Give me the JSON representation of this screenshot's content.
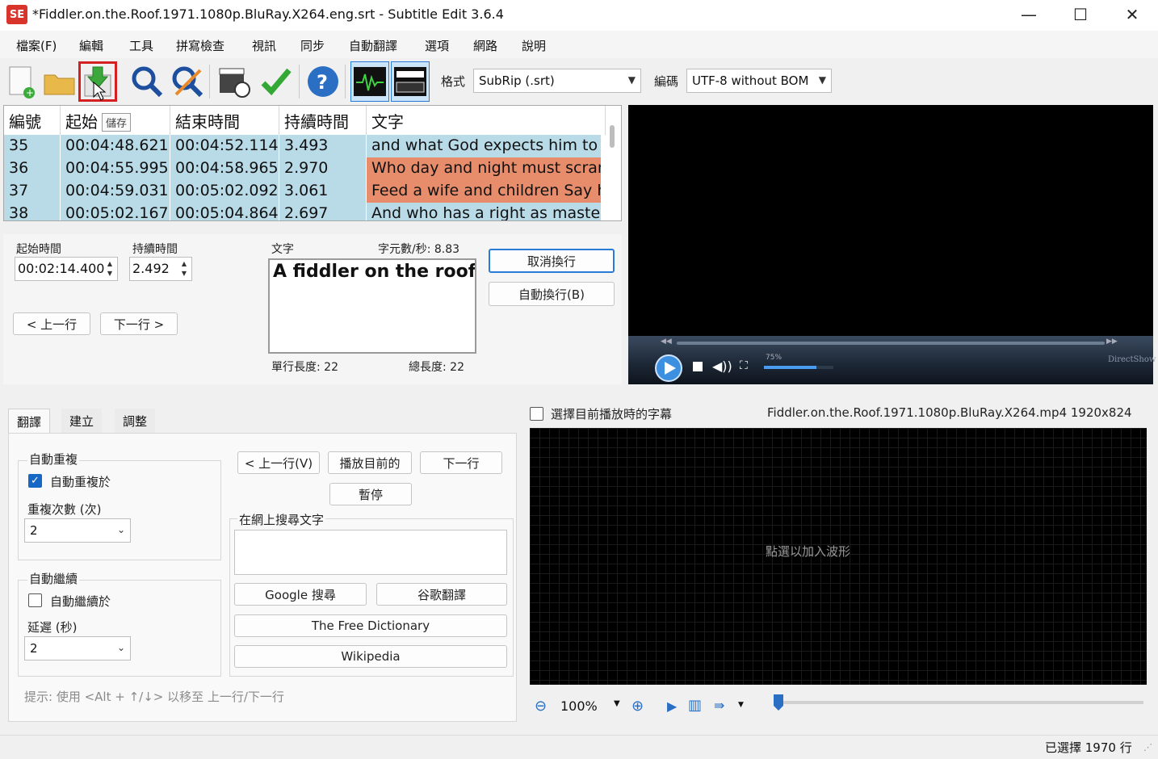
{
  "window": {
    "title": "*Fiddler.on.the.Roof.1971.1080p.BluRay.X264.eng.srt - Subtitle Edit 3.6.4",
    "app_icon_text": "SE",
    "minimize": "—",
    "maximize": "☐",
    "close": "✕"
  },
  "menu": [
    "檔案(F)",
    "編輯",
    "工具",
    "拼寫檢查",
    "視訊",
    "同步",
    "自動翻譯",
    "選項",
    "網路",
    "說明"
  ],
  "toolbar": {
    "format_label": "格式",
    "format_value": "SubRip (.srt)",
    "encoding_label": "編碼",
    "encoding_value": "UTF-8 without BOM",
    "tooltip": "儲存"
  },
  "grid": {
    "headers": [
      "編號",
      "起始",
      "結束時間",
      "持續時間",
      "文字"
    ],
    "rows": [
      {
        "num": "35",
        "start": "00:04:48.621",
        "end": "00:04:52.114",
        "dur": "3.493",
        "text": "and what God expects him to do.",
        "highlight": false
      },
      {
        "num": "36",
        "start": "00:04:55.995",
        "end": "00:04:58.965",
        "dur": "2.970",
        "text": "Who day and night must scramb",
        "highlight": true
      },
      {
        "num": "37",
        "start": "00:04:59.031",
        "end": "00:05:02.092",
        "dur": "3.061",
        "text": "Feed a wife and children Say his d",
        "highlight": true
      },
      {
        "num": "38",
        "start": "00:05:02.167",
        "end": "00:05:04.864",
        "dur": "2.697",
        "text": "And who has a right as master of",
        "highlight": false
      }
    ]
  },
  "edit": {
    "start_label": "起始時間",
    "start_value": "00:02:14.400",
    "duration_label": "持續時間",
    "duration_value": "2.492",
    "text_label": "文字",
    "cps_label": "字元數/秒: 8.83",
    "text_value": "A fiddler on the roof.",
    "line_length": "單行長度: 22",
    "total_length": "總長度: 22",
    "prev_btn": "< 上一行",
    "next_btn": "下一行 >",
    "unbreak_btn": "取消換行",
    "autobreak_btn": "自動換行(B)"
  },
  "video": {
    "volume_pct": "75%",
    "renderer": "DirectShow"
  },
  "bottom": {
    "tabs": [
      "翻譯",
      "建立",
      "調整"
    ],
    "auto_repeat_group": "自動重複",
    "auto_repeat_chk": "自動重複於",
    "repeat_count_label": "重複次數 (次)",
    "repeat_count_value": "2",
    "auto_continue_group": "自動繼續",
    "auto_continue_chk": "自動繼續於",
    "delay_label": "延遲 (秒)",
    "delay_value": "2",
    "hint": "提示: 使用 <Alt + ↑/↓> 以移至 上一行/下一行",
    "prev_btn": "< 上一行(V)",
    "play_current_btn": "播放目前的",
    "next_btn": "下一行",
    "pause_btn": "暫停",
    "search_label": "在網上搜尋文字",
    "google_search_btn": "Google 搜尋",
    "google_translate_btn": "谷歌翻譯",
    "free_dictionary_btn": "The Free Dictionary",
    "wikipedia_btn": "Wikipedia"
  },
  "waveform": {
    "select_current_chk": "選擇目前播放時的字幕",
    "video_info": "Fiddler.on.the.Roof.1971.1080p.BluRay.X264.mp4 1920x824",
    "placeholder": "點選以加入波形",
    "zoom_value": "100%"
  },
  "status": {
    "selected": "已選擇 1970 行"
  }
}
